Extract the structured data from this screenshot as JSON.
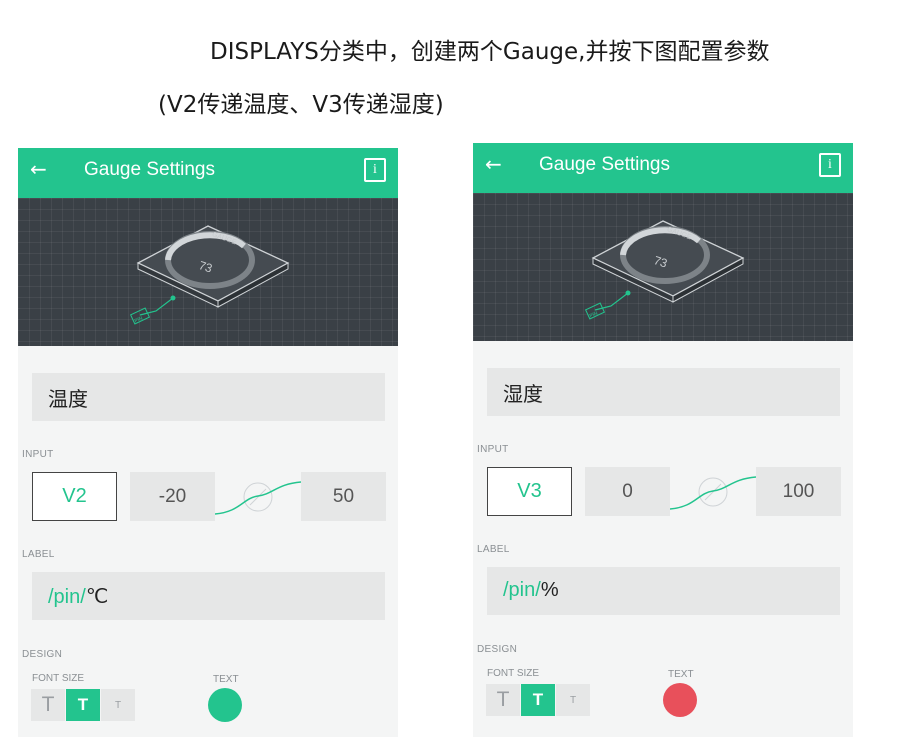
{
  "instruction": {
    "line1": "DISPLAYS分类中，创建两个Gauge,并按下图配置参数",
    "line2": "(V2传递温度、V3传递湿度)"
  },
  "panels": [
    {
      "header": {
        "back_icon": "←",
        "title": "Gauge Settings",
        "info_icon": "i"
      },
      "preview": {
        "gauge_title": "GAUGE",
        "gauge_value": "73",
        "pin_tag": "PIN"
      },
      "name": "温度",
      "input": {
        "section_label": "INPUT",
        "pin": "V2",
        "min": "-20",
        "max": "50"
      },
      "label": {
        "section_label": "LABEL",
        "pin_text": "/pin/",
        "unit_text": "℃"
      },
      "design": {
        "section_label": "DESIGN",
        "font_size_label": "FONT SIZE",
        "font_sizes": [
          "T",
          "T",
          "T"
        ],
        "selected_font_size": 1,
        "text_label": "TEXT",
        "text_color": "#23c48e"
      }
    },
    {
      "header": {
        "back_icon": "←",
        "title": "Gauge Settings",
        "info_icon": "i"
      },
      "preview": {
        "gauge_title": "GAUGE",
        "gauge_value": "73",
        "pin_tag": "PIN"
      },
      "name": "湿度",
      "input": {
        "section_label": "INPUT",
        "pin": "V3",
        "min": "0",
        "max": "100"
      },
      "label": {
        "section_label": "LABEL",
        "pin_text": "/pin/",
        "unit_text": "%"
      },
      "design": {
        "section_label": "DESIGN",
        "font_size_label": "FONT SIZE",
        "font_sizes": [
          "T",
          "T",
          "T"
        ],
        "selected_font_size": 1,
        "text_label": "TEXT",
        "text_color": "#e8505b"
      }
    }
  ],
  "colors": {
    "accent": "#23c48e",
    "header": "#23c48e",
    "preview_bg": "#3a4046"
  }
}
